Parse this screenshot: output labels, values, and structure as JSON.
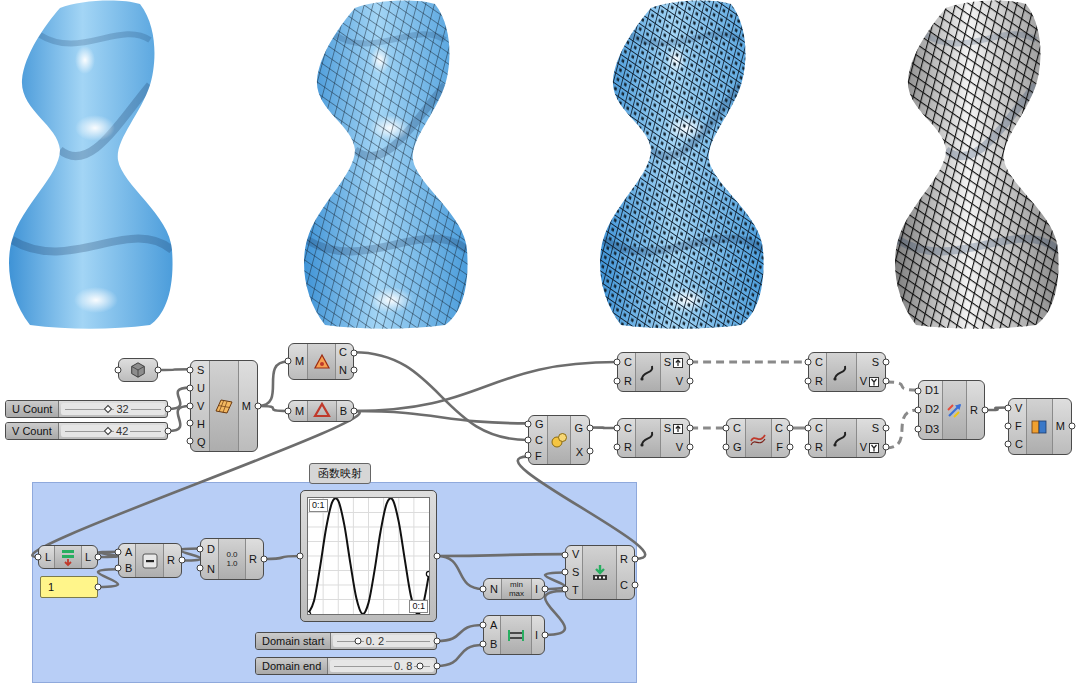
{
  "renders": [
    {
      "kind": "smooth"
    },
    {
      "kind": "grid"
    },
    {
      "kind": "panels"
    },
    {
      "kind": "lattice"
    }
  ],
  "canvas": {
    "nodes": [
      {
        "kind": "param"
      },
      {
        "kind": "slider",
        "label": "U Count",
        "value": "32",
        "level": 0.45,
        "handle": "diamond"
      },
      {
        "kind": "slider",
        "label": "V Count",
        "value": "42",
        "level": 0.45,
        "handle": "diamond"
      },
      {
        "kind": "component",
        "inputs": [
          "S",
          "U",
          "V",
          "H",
          "Q"
        ],
        "outputs": [
          {
            "label": "M",
            "flag": "none"
          }
        ]
      },
      {
        "kind": "component",
        "inputs": [
          "M"
        ],
        "outputs": [
          {
            "label": "C",
            "flag": "none"
          },
          {
            "label": "N",
            "flag": "none"
          }
        ]
      },
      {
        "kind": "component",
        "inputs": [
          "M"
        ],
        "outputs": [
          {
            "label": "B",
            "flag": "none"
          }
        ]
      },
      {
        "kind": "component",
        "inputs": [
          "G",
          "C",
          "F"
        ],
        "outputs": [
          {
            "label": "G",
            "flag": "none"
          },
          {
            "label": "X",
            "flag": "none"
          }
        ]
      },
      {
        "kind": "component",
        "inputs": [
          "C",
          "R"
        ],
        "outputs": [
          {
            "label": "S",
            "flag": "flatten"
          },
          {
            "label": "V",
            "flag": "none"
          }
        ]
      },
      {
        "kind": "component",
        "inputs": [
          "C",
          "R"
        ],
        "outputs": [
          {
            "label": "S",
            "flag": "none"
          },
          {
            "label": "V",
            "flag": "graft"
          }
        ]
      },
      {
        "kind": "component",
        "inputs": [
          "C",
          "R"
        ],
        "outputs": [
          {
            "label": "S",
            "flag": "flatten"
          },
          {
            "label": "V",
            "flag": "none"
          }
        ]
      },
      {
        "kind": "component",
        "inputs": [
          "C",
          "G"
        ],
        "outputs": [
          {
            "label": "C",
            "flag": "none"
          },
          {
            "label": "F",
            "flag": "none"
          }
        ]
      },
      {
        "kind": "component",
        "inputs": [
          "C",
          "R"
        ],
        "outputs": [
          {
            "label": "S",
            "flag": "none"
          },
          {
            "label": "V",
            "flag": "graft"
          }
        ]
      },
      {
        "kind": "component",
        "inputs": [
          "D1",
          "D2",
          "D3"
        ],
        "outputs": [
          {
            "label": "R",
            "flag": "none"
          }
        ]
      },
      {
        "kind": "component",
        "inputs": [
          "V",
          "F",
          "C"
        ],
        "outputs": [
          {
            "label": "M",
            "flag": "none"
          }
        ]
      },
      {
        "kind": "component",
        "inputs": [
          "L"
        ],
        "outputs": [
          {
            "label": "L",
            "flag": "none"
          }
        ]
      },
      {
        "kind": "panel",
        "text": "1"
      },
      {
        "kind": "component",
        "inputs": [
          "A",
          "B"
        ],
        "outputs": [
          {
            "label": "R",
            "flag": "none"
          }
        ]
      },
      {
        "kind": "component",
        "inputs": [
          "D",
          "N"
        ],
        "outputs": [
          {
            "label": "R",
            "flag": "none"
          }
        ],
        "icon_text": [
          "0.0",
          "1.0"
        ]
      },
      {
        "kind": "graph",
        "label": "函数映射",
        "corners": [
          "0:1",
          "0:1"
        ],
        "curve": [
          0,
          0.115,
          0.406,
          0.741,
          0.965,
          0.976,
          0.768,
          0.437,
          0.136,
          0.001,
          0.096,
          0.376,
          0.713,
          0.952,
          0.984,
          0.794,
          0.469,
          0.158,
          0.004,
          0.078,
          0.345
        ]
      },
      {
        "kind": "component",
        "inputs": [
          "N"
        ],
        "outputs": [
          {
            "label": "I",
            "flag": "none"
          }
        ],
        "icon_text": [
          "min",
          "max"
        ]
      },
      {
        "kind": "component",
        "inputs": [
          "V",
          "S",
          "T"
        ],
        "outputs": [
          {
            "label": "R",
            "flag": "none"
          },
          {
            "label": "C",
            "flag": "none"
          }
        ]
      },
      {
        "kind": "component",
        "inputs": [
          "A",
          "B"
        ],
        "outputs": [
          {
            "label": "I",
            "flag": "none"
          }
        ]
      },
      {
        "kind": "slider",
        "label": "Domain start",
        "value": "0. 2",
        "level": 0.22,
        "handle": "circle"
      },
      {
        "kind": "slider",
        "label": "Domain end",
        "value": "0. 8",
        "level": 0.9,
        "handle": "circle"
      }
    ]
  }
}
